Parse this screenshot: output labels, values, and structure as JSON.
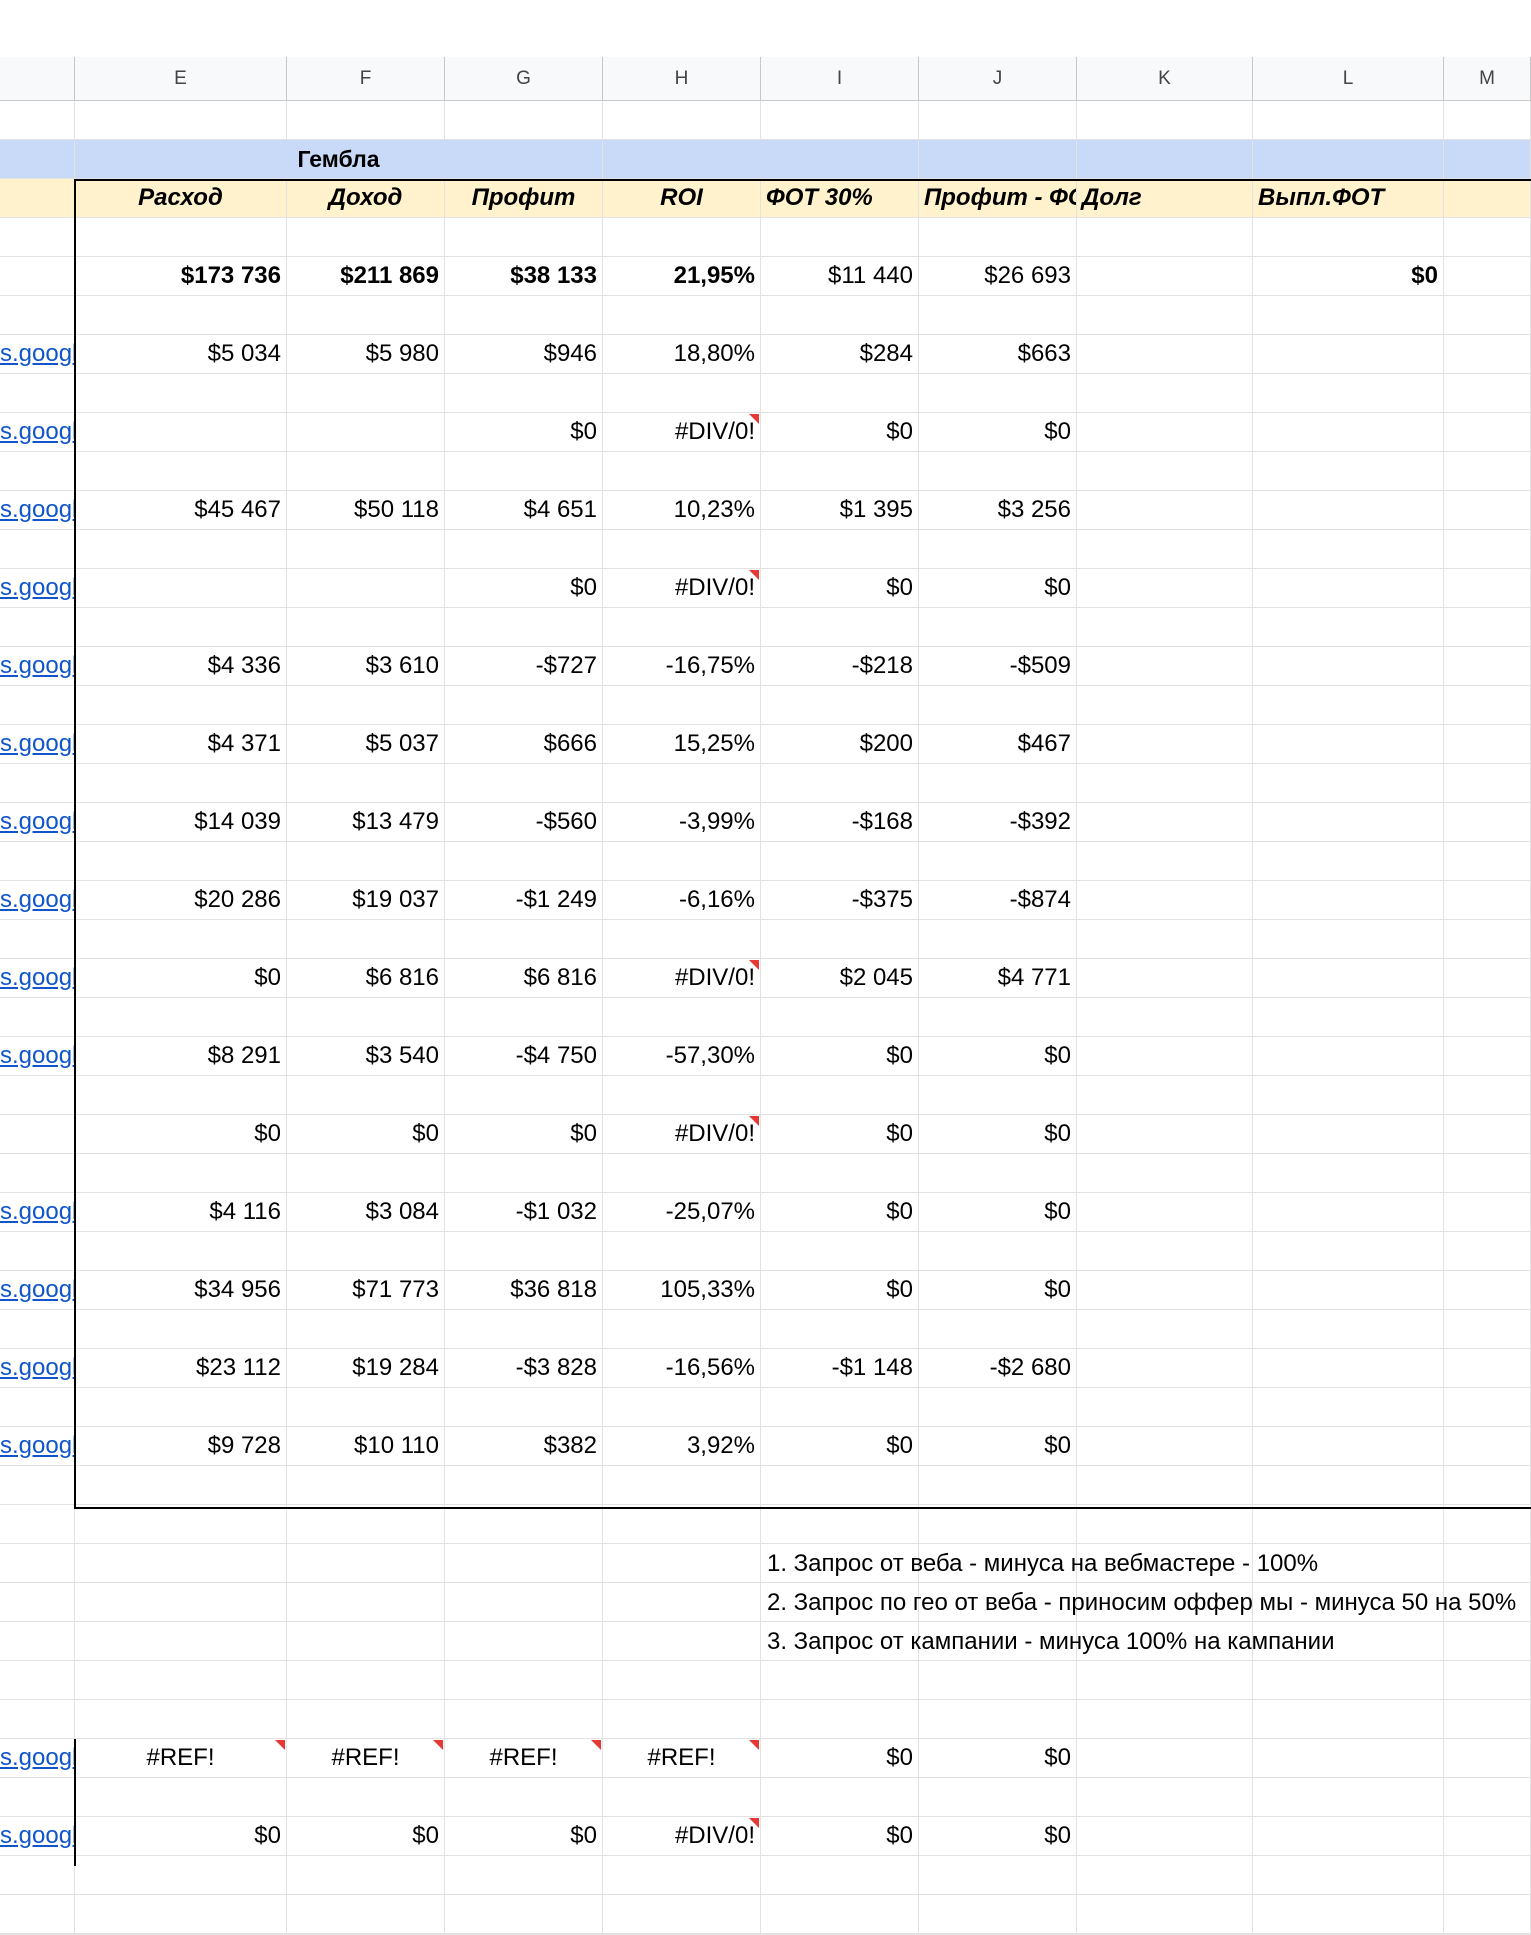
{
  "columns": [
    "E",
    "F",
    "G",
    "H",
    "I",
    "J",
    "K",
    "L",
    "M"
  ],
  "group_title": "Гембла",
  "headers": {
    "expense": "Расход",
    "income": "Доход",
    "profit": "Профит",
    "roi": "ROI",
    "fot": "ФОТ 30%",
    "profit_minus_fot": "Профит - ФОТ",
    "debt": "Долг",
    "fot_paid": "Выпл.ФОТ"
  },
  "totals": {
    "expense": "$173 736",
    "income": "$211 869",
    "profit": "$38 133",
    "roi": "21,95%",
    "fot": "$11 440",
    "profit_minus_fot": "$26 693",
    "fot_paid": "$0"
  },
  "link_text": "s.googl",
  "rows": [
    {
      "link": true,
      "expense": "$5 034",
      "income": "$5 980",
      "profit": "$946",
      "roi": "18,80%",
      "roi_err": false,
      "fot": "$284",
      "pmf": "$663"
    },
    {
      "link": true,
      "expense": "",
      "income": "",
      "profit": "$0",
      "roi": "#DIV/0!",
      "roi_err": true,
      "fot": "$0",
      "pmf": "$0"
    },
    {
      "link": true,
      "expense": "$45 467",
      "income": "$50 118",
      "profit": "$4 651",
      "roi": "10,23%",
      "roi_err": false,
      "fot": "$1 395",
      "pmf": "$3 256"
    },
    {
      "link": true,
      "expense": "",
      "income": "",
      "profit": "$0",
      "roi": "#DIV/0!",
      "roi_err": true,
      "fot": "$0",
      "pmf": "$0"
    },
    {
      "link": true,
      "expense": "$4 336",
      "income": "$3 610",
      "profit": "-$727",
      "roi": "-16,75%",
      "roi_err": false,
      "fot": "-$218",
      "pmf": "-$509"
    },
    {
      "link": true,
      "expense": "$4 371",
      "income": "$5 037",
      "profit": "$666",
      "roi": "15,25%",
      "roi_err": false,
      "fot": "$200",
      "pmf": "$467"
    },
    {
      "link": true,
      "expense": "$14 039",
      "income": "$13 479",
      "profit": "-$560",
      "roi": "-3,99%",
      "roi_err": false,
      "fot": "-$168",
      "pmf": "-$392"
    },
    {
      "link": true,
      "expense": "$20 286",
      "income": "$19 037",
      "profit": "-$1 249",
      "roi": "-6,16%",
      "roi_err": false,
      "fot": "-$375",
      "pmf": "-$874"
    },
    {
      "link": true,
      "expense": "$0",
      "income": "$6 816",
      "profit": "$6 816",
      "roi": "#DIV/0!",
      "roi_err": true,
      "fot": "$2 045",
      "pmf": "$4 771"
    },
    {
      "link": true,
      "expense": "$8 291",
      "income": "$3 540",
      "profit": "-$4 750",
      "roi": "-57,30%",
      "roi_err": false,
      "fot": "$0",
      "pmf": "$0"
    },
    {
      "link": false,
      "expense": "$0",
      "income": "$0",
      "profit": "$0",
      "roi": "#DIV/0!",
      "roi_err": true,
      "fot": "$0",
      "pmf": "$0"
    },
    {
      "link": true,
      "expense": "$4 116",
      "income": "$3 084",
      "profit": "-$1 032",
      "roi": "-25,07%",
      "roi_err": false,
      "fot": "$0",
      "pmf": "$0"
    },
    {
      "link": true,
      "expense": "$34 956",
      "income": "$71 773",
      "profit": "$36 818",
      "roi": "105,33%",
      "roi_err": false,
      "fot": "$0",
      "pmf": "$0"
    },
    {
      "link": true,
      "expense": "$23 112",
      "income": "$19 284",
      "profit": "-$3 828",
      "roi": "-16,56%",
      "roi_err": false,
      "fot": "-$1 148",
      "pmf": "-$2 680"
    },
    {
      "link": true,
      "expense": "$9 728",
      "income": "$10 110",
      "profit": "$382",
      "roi": "3,92%",
      "roi_err": false,
      "fot": "$0",
      "pmf": "$0"
    }
  ],
  "notes": [
    "1. Запрос от веба - минуса на вебмастере  - 100%",
    "2. Запрос по гео от веба - приносим оффер мы - минуса 50 на 50%",
    "3. Запрос от кампании - минуса 100% на кампании"
  ],
  "bottom_rows": [
    {
      "expense": "#REF!",
      "income": "#REF!",
      "profit": "#REF!",
      "roi": "#REF!",
      "fot": "$0",
      "pmf": "$0",
      "err": true
    },
    {
      "expense": "$0",
      "income": "$0",
      "profit": "$0",
      "roi": "#DIV/0!",
      "fot": "$0",
      "pmf": "$0",
      "err": false
    }
  ]
}
